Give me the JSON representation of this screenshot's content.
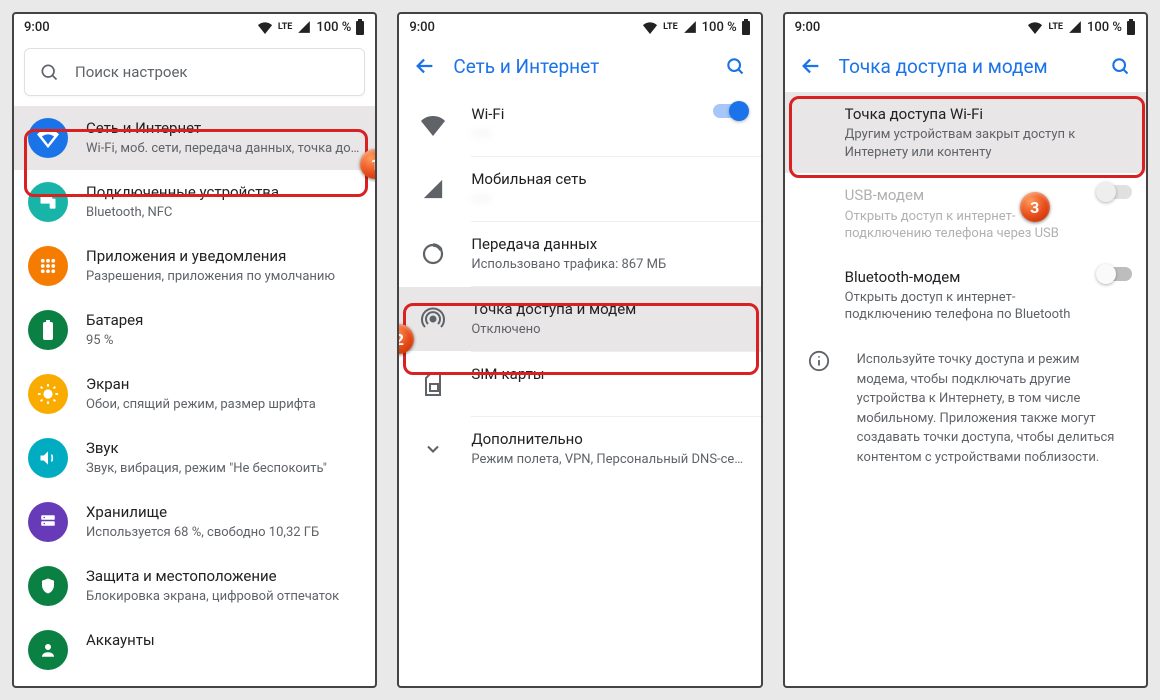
{
  "status": {
    "time": "9:00",
    "battery": "100 %",
    "net": "LTE"
  },
  "screen1": {
    "search_placeholder": "Поиск настроек",
    "items": [
      {
        "title": "Сеть и Интернет",
        "sub": "Wi-Fi, моб. сети, передача данных, точка дост..."
      },
      {
        "title": "Подключенные устройства",
        "sub": "Bluetooth, NFC"
      },
      {
        "title": "Приложения и уведомления",
        "sub": "Разрешения, приложения по умолчанию"
      },
      {
        "title": "Батарея",
        "sub": "95 %"
      },
      {
        "title": "Экран",
        "sub": "Обои, спящий режим, размер шрифта"
      },
      {
        "title": "Звук",
        "sub": "Звук, вибрация, режим \"Не беспокоить\""
      },
      {
        "title": "Хранилище",
        "sub": "Используется 68 %, свободно 10,32 ГБ"
      },
      {
        "title": "Защита и местоположение",
        "sub": "Блокировка экрана, цифровой отпечаток"
      },
      {
        "title": "Аккаунты",
        "sub": ""
      }
    ]
  },
  "screen2": {
    "title": "Сеть и Интернет",
    "items": [
      {
        "title": "Wi-Fi",
        "sub": "——"
      },
      {
        "title": "Мобильная сеть",
        "sub": "——"
      },
      {
        "title": "Передача данных",
        "sub": "Использовано трафика: 867 МБ"
      },
      {
        "title": "Точка доступа и модем",
        "sub": "Отключено"
      },
      {
        "title": "SIM-карты",
        "sub": ""
      },
      {
        "title": "Дополнительно",
        "sub": "Режим полета, VPN, Персональный DNS-сер..."
      }
    ]
  },
  "screen3": {
    "title": "Точка доступа и модем",
    "items": [
      {
        "title": "Точка доступа Wi-Fi",
        "sub": "Другим устройствам закрыт доступ к Интернету или контенту"
      },
      {
        "title": "USB-модем",
        "sub": "Открыть доступ к интернет-подключению телефона через USB"
      },
      {
        "title": "Bluetooth-модем",
        "sub": "Открыть доступ к интернет-подключению телефона по Bluetooth"
      }
    ],
    "info": "Используйте точку доступа и режим модема, чтобы подключать другие устройства к Интернету, в том числе мобильному. Приложения также могут создавать точки доступа, чтобы делиться контентом с устройствами поблизости."
  },
  "badges": {
    "b1": "1",
    "b2": "2",
    "b3": "3"
  }
}
